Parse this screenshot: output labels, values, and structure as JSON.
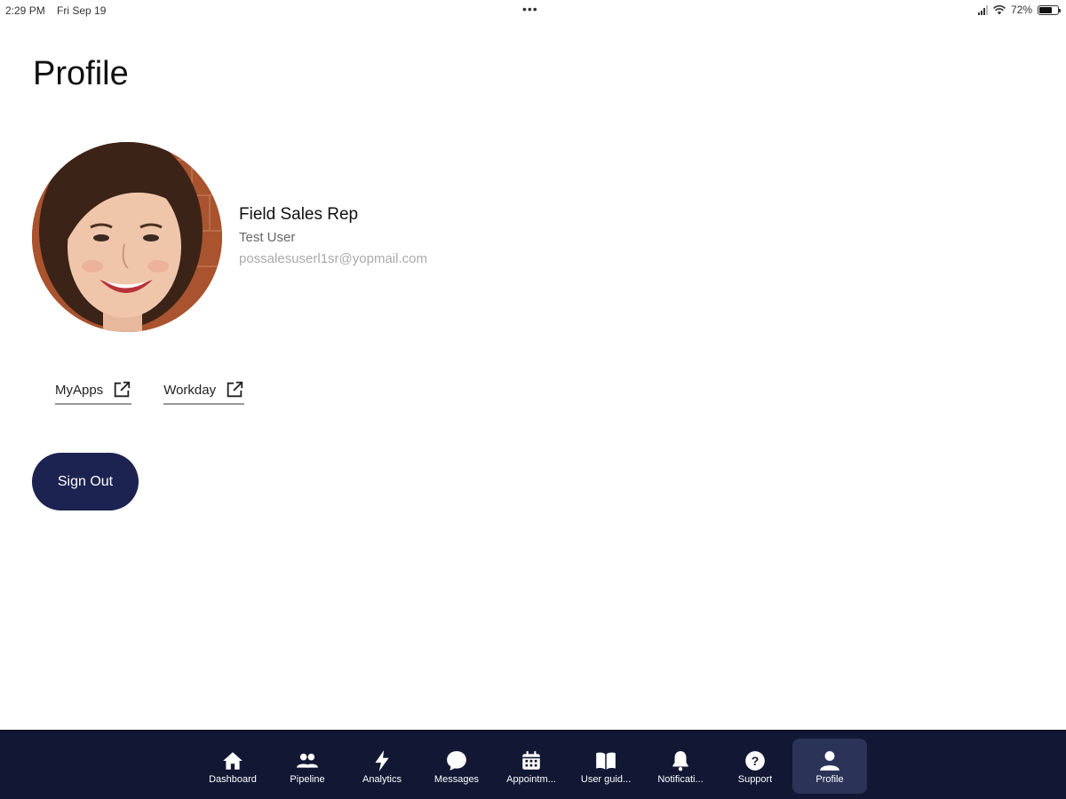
{
  "status_bar": {
    "time": "2:29 PM",
    "date": "Fri Sep 19",
    "dots": "•••",
    "battery": "72%",
    "battery_level": 0.72
  },
  "page": {
    "title": "Profile"
  },
  "profile": {
    "role": "Field Sales Rep",
    "name": "Test User",
    "email": "possalesuserl1sr@yopmail.com"
  },
  "links": [
    {
      "label": "MyApps",
      "icon": "external-link-icon"
    },
    {
      "label": "Workday",
      "icon": "external-link-icon"
    }
  ],
  "sign_out": {
    "label": "Sign Out"
  },
  "colors": {
    "primary": "#1c2350",
    "nav_background": "#121834",
    "nav_active": "#2c3358"
  },
  "nav": {
    "items": [
      {
        "label": "Dashboard",
        "icon": "home-icon"
      },
      {
        "label": "Pipeline",
        "icon": "people-icon"
      },
      {
        "label": "Analytics",
        "icon": "lightning-icon"
      },
      {
        "label": "Messages",
        "icon": "chat-bubble-icon"
      },
      {
        "label": "Appointm...",
        "icon": "calendar-icon"
      },
      {
        "label": "User guid...",
        "icon": "book-icon"
      },
      {
        "label": "Notificati...",
        "icon": "bell-icon"
      },
      {
        "label": "Support",
        "icon": "help-icon"
      },
      {
        "label": "Profile",
        "icon": "person-icon",
        "active": true
      }
    ]
  }
}
